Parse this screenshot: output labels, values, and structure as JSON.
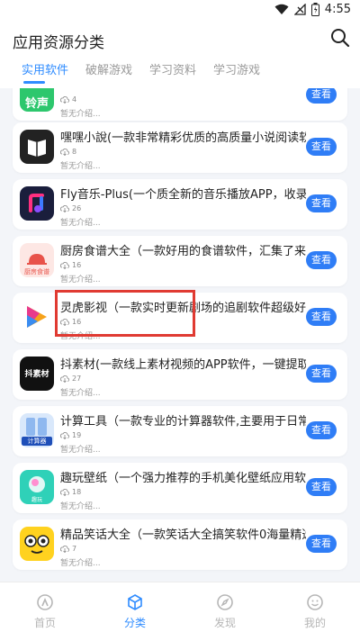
{
  "status_bar": {
    "time": "4:55"
  },
  "header": {
    "title": "应用资源分类"
  },
  "tabs": [
    {
      "label": "实用软件",
      "active": true
    },
    {
      "label": "破解游戏",
      "active": false
    },
    {
      "label": "学习资料",
      "active": false
    },
    {
      "label": "学习游戏",
      "active": false
    }
  ],
  "apps": [
    {
      "name": "铃声",
      "downloads": "4",
      "desc": "暂无介绍...",
      "button": "查看",
      "icon": "ringtone-icon"
    },
    {
      "name": "嘿嘿小說(一款非常精彩优质的高质量小说阅读软件",
      "downloads": "8",
      "desc": "暂无介绍...",
      "button": "查看",
      "icon": "book-icon"
    },
    {
      "name": "Fly音乐-Plus(一个质全新的音乐播放APP，收录全",
      "downloads": "26",
      "desc": "暂无介绍...",
      "button": "查看",
      "icon": "music-icon"
    },
    {
      "name": "厨房食谱大全（一款好用的食谱软件，汇集了来自",
      "downloads": "16",
      "desc": "暂无介绍...",
      "button": "查看",
      "icon": "kitchen-icon",
      "icon_text": "厨房食谱"
    },
    {
      "name": "灵虎影视（一款实时更新剧场的追剧软件超级好用",
      "downloads": "16",
      "desc": "暂无介绍...",
      "button": "查看",
      "icon": "video-icon"
    },
    {
      "name": "抖素材(一款线上素材视频的APP软件，一键提取视",
      "downloads": "27",
      "desc": "暂无介绍...",
      "button": "查看",
      "icon": "material-icon",
      "icon_text": "抖素材"
    },
    {
      "name": "计算工具（一款专业的计算器软件,主要用于日常的",
      "downloads": "19",
      "desc": "暂无介绍...",
      "button": "查看",
      "icon": "calculator-icon",
      "icon_text": "计算器"
    },
    {
      "name": "趣玩壁纸（一个强力推荐的手机美化壁纸应用软件",
      "downloads": "18",
      "desc": "暂无介绍...",
      "button": "查看",
      "icon": "wallpaper-icon",
      "icon_text": "趣玩"
    },
    {
      "name": "精品笑话大全（一款笑话大全搞笑软件0海量精选",
      "downloads": "7",
      "desc": "暂无介绍...",
      "button": "查看",
      "icon": "joke-icon"
    }
  ],
  "bottom_nav": [
    {
      "label": "首页",
      "active": false,
      "icon": "home-icon"
    },
    {
      "label": "分类",
      "active": true,
      "icon": "category-icon"
    },
    {
      "label": "发现",
      "active": false,
      "icon": "compass-icon"
    },
    {
      "label": "我的",
      "active": false,
      "icon": "profile-icon"
    }
  ],
  "colors": {
    "accent": "#2f8cff",
    "button": "#2f7df6",
    "highlight": "#e03a32",
    "background": "#f3f5f9"
  }
}
